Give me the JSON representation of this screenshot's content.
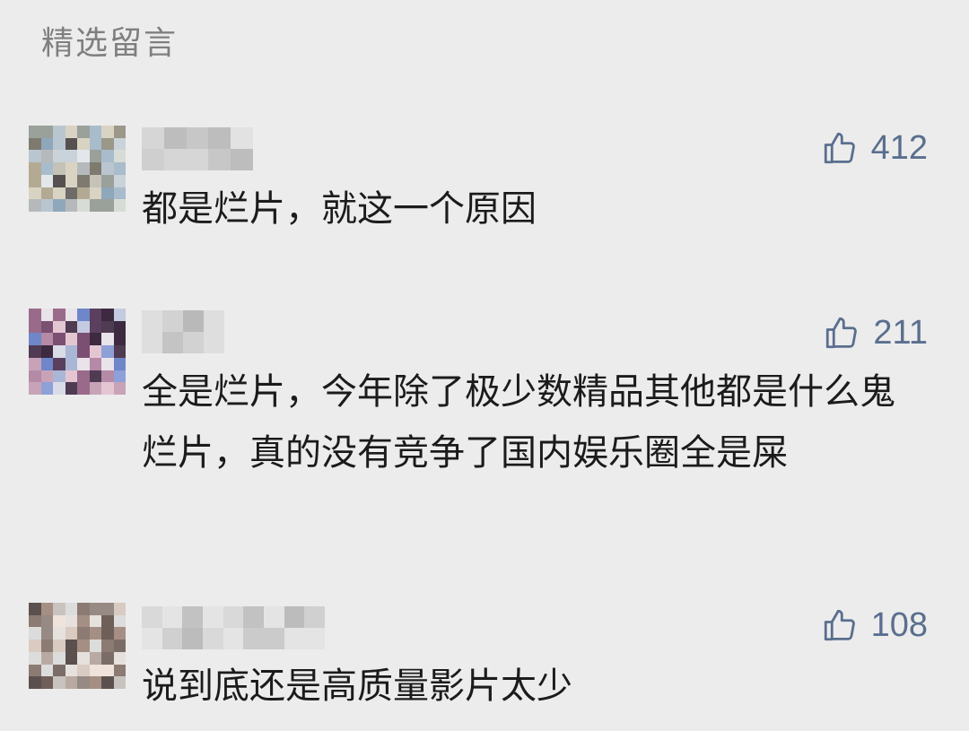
{
  "section": {
    "title": "精选留言"
  },
  "comments": [
    {
      "nickname": "",
      "text": "都是烂片，就这一个原因",
      "likes": "412",
      "like_icon": "thumbs-up-icon"
    },
    {
      "nickname": "",
      "text": "全是烂片，今年除了极少数精品其他都是什么鬼烂片，真的没有竞争了国内娱乐圈全是屎",
      "likes": "211",
      "like_icon": "thumbs-up-icon"
    },
    {
      "nickname": "",
      "text": "说到底还是高质量影片太少",
      "likes": "108",
      "like_icon": "thumbs-up-icon"
    }
  ],
  "colors": {
    "background": "#ececec",
    "like_accent": "#5a6f8e",
    "text": "#1b1b1b",
    "section_title": "#7f7f7f"
  }
}
